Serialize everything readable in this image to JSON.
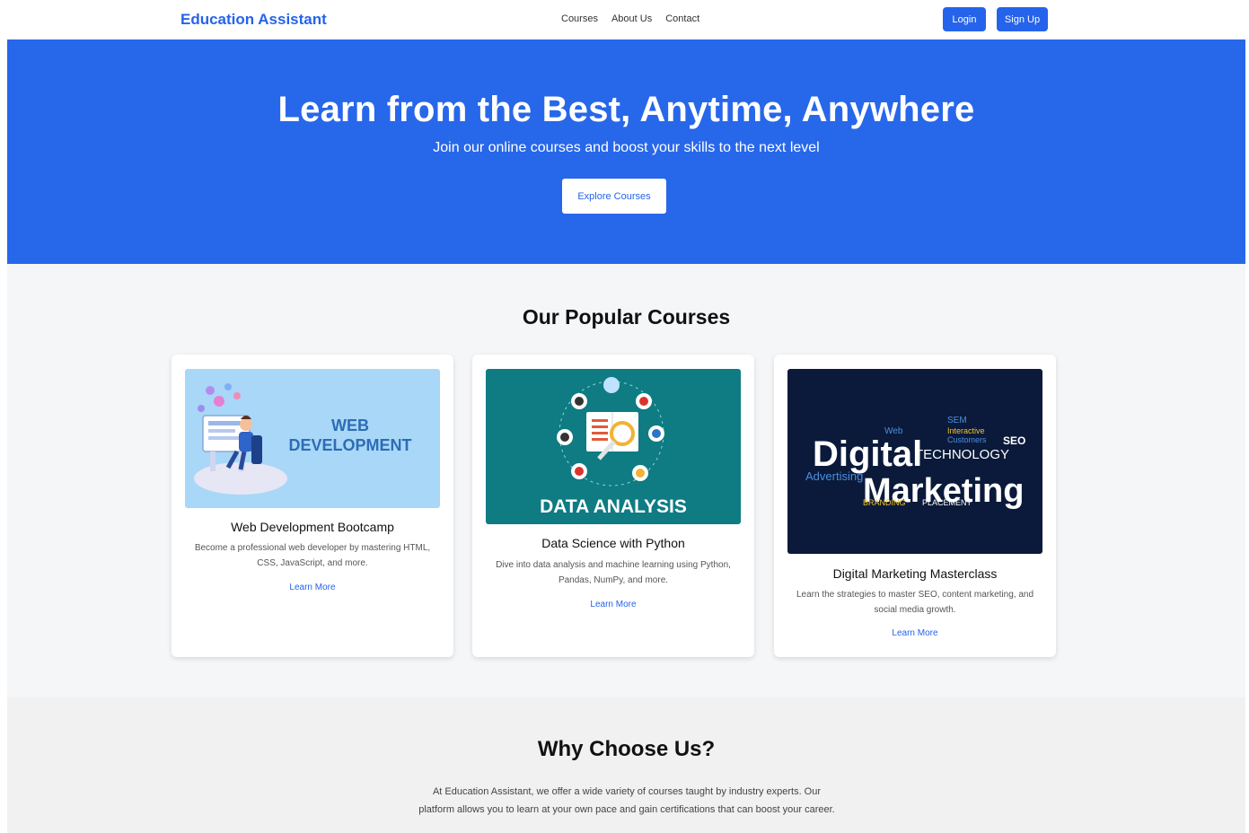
{
  "nav": {
    "brand": "Education Assistant",
    "links": [
      "Courses",
      "About Us",
      "Contact"
    ],
    "login": "Login",
    "signup": "Sign Up"
  },
  "hero": {
    "title": "Learn from the Best, Anytime, Anywhere",
    "subtitle": "Join our online courses and boost your skills to the next level",
    "button": "Explore Courses"
  },
  "courses": {
    "title": "Our Popular Courses",
    "items": [
      {
        "title": "Web Development Bootcamp",
        "description": "Become a professional web developer by mastering HTML, CSS, JavaScript, and more.",
        "link": "Learn More",
        "image_text": [
          "WEB",
          "DEVELOPMENT"
        ]
      },
      {
        "title": "Data Science with Python",
        "description": "Dive into data analysis and machine learning using Python, Pandas, NumPy, and more.",
        "link": "Learn More",
        "image_text": [
          "DATA ANALYSIS"
        ]
      },
      {
        "title": "Digital Marketing Masterclass",
        "description": "Learn the strategies to master SEO, content marketing, and social media growth.",
        "link": "Learn More",
        "image_text": [
          "Digital",
          "Marketing",
          "TECHNOLOGY",
          "Advertising",
          "BRANDING",
          "PLACEMENT",
          "SEO",
          "SEM",
          "Web",
          "Interactive",
          "Customers"
        ]
      }
    ]
  },
  "why": {
    "title": "Why Choose Us?",
    "text_line1": "At Education Assistant, we offer a wide variety of courses taught by industry experts. Our",
    "text_line2": "platform allows you to learn at your own pace and gain certifications that can boost your career."
  },
  "colors": {
    "primary": "#2563eb",
    "hero_bg": "#2767ea",
    "section_bg": "#f5f6f8"
  }
}
